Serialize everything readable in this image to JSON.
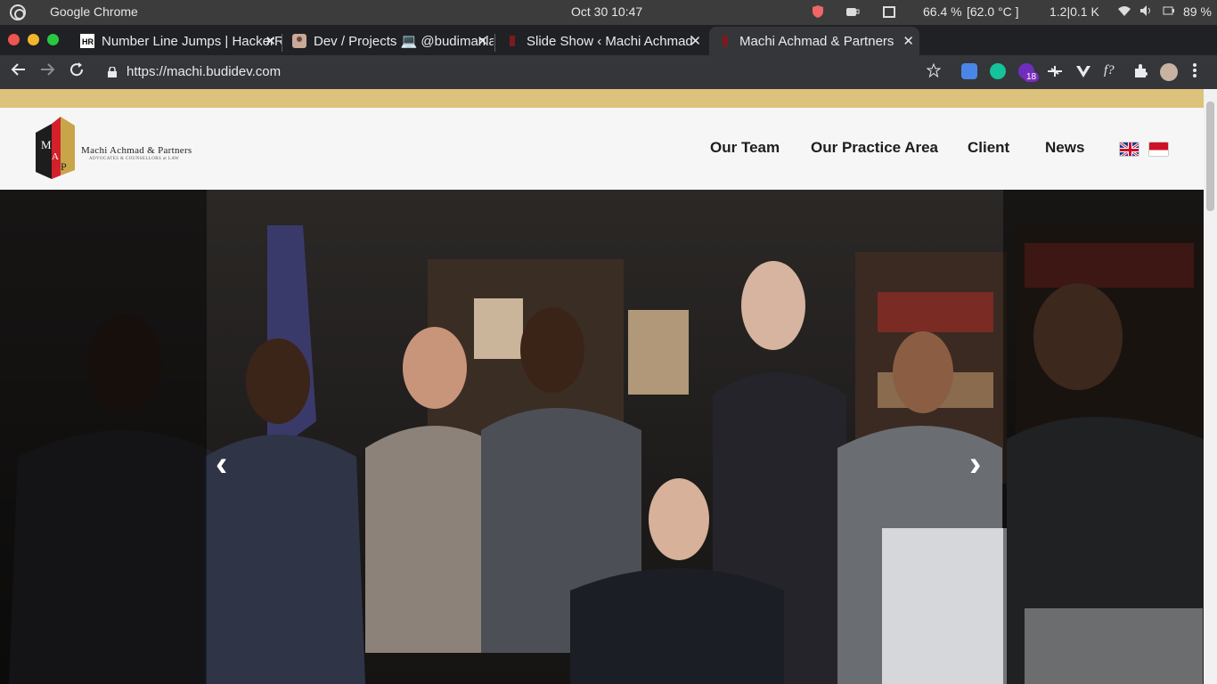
{
  "os": {
    "app_name": "Google Chrome",
    "clock": "Oct 30  10:47",
    "cpu": "66.4 %",
    "temp": "[62.0 °C ]",
    "net": "1.2|0.1 K",
    "battery": "89 %"
  },
  "tabs": [
    {
      "title": "Number Line Jumps | HackerRank"
    },
    {
      "title": "Dev / Projects 💻 @budimanlai"
    },
    {
      "title": "Slide Show ‹ Machi Achmad"
    },
    {
      "title": "Machi Achmad & Partners"
    }
  ],
  "toolbar": {
    "url": "https://machi.budidev.com",
    "ext_badge": "18"
  },
  "site": {
    "brand": "Machi Achmad & Partners",
    "brand_sub": "ADVOCATES & COUNSELLORS at LAW",
    "logo_letters": "MA&P",
    "nav": [
      "Our Team",
      "Our Practice Area",
      "Client",
      "News"
    ],
    "languages": [
      "English",
      "Indonesia"
    ]
  },
  "slider": {
    "prev": "‹",
    "next": "›"
  },
  "colors": {
    "gold": "#dcc27a",
    "header_bg": "#f6f6f6",
    "logo_red": "#d3202a"
  }
}
